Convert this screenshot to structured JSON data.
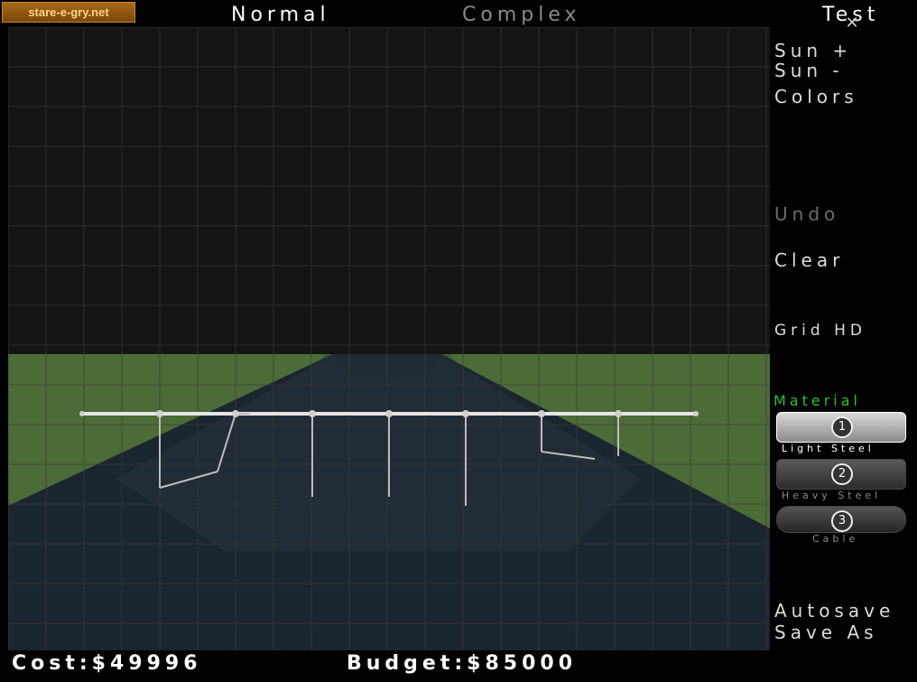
{
  "top": {
    "logo": "stare-e-gry.net",
    "modes": {
      "normal": "Normal",
      "complex": "Complex",
      "test": "Test"
    },
    "close_icon": "close-icon"
  },
  "side": {
    "sun_plus": "Sun  +",
    "sun_minus": "Sun  -",
    "colors": "Colors",
    "undo": "Undo",
    "clear": "Clear",
    "grid": "Grid HD",
    "material_title": "Material",
    "materials": [
      {
        "num": "1",
        "label": "Light Steel",
        "selected": true
      },
      {
        "num": "2",
        "label": "Heavy Steel",
        "selected": false
      },
      {
        "num": "3",
        "label": "Cable",
        "selected": false
      }
    ],
    "autosave": "Autosave",
    "save_as": "Save As"
  },
  "bottom": {
    "cost": "Cost:$49996",
    "budget": "Budget:$85000"
  },
  "colors": {
    "accent_green": "#2fbf2f",
    "ground": "#4d6b3a",
    "river": "#1b2530"
  }
}
